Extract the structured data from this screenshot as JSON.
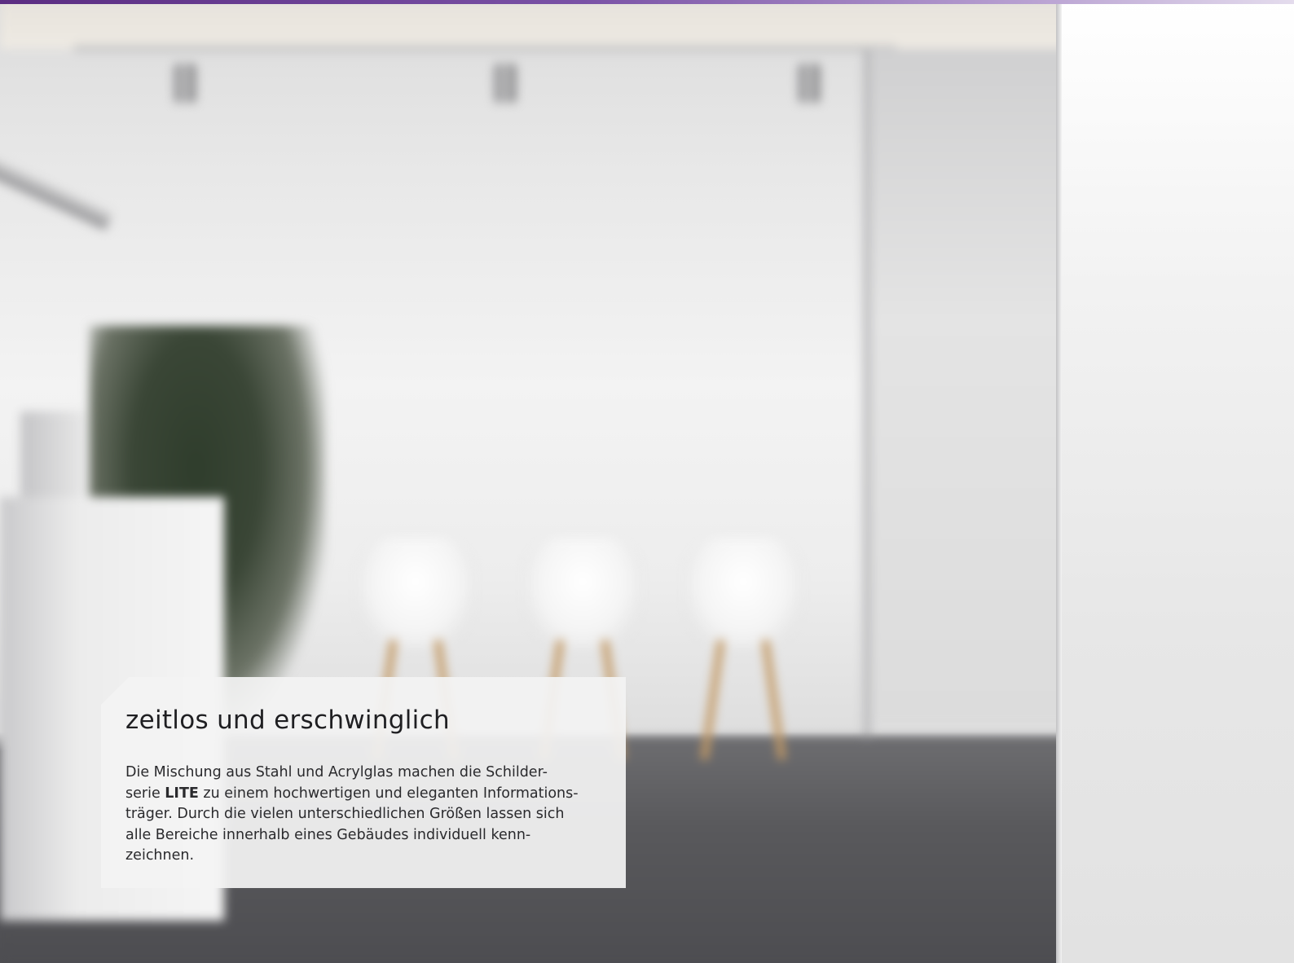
{
  "colors": {
    "accent_bar_start": "#5b2d82",
    "accent_bar_end": "#e4dced",
    "card_background": "#f3f3f3",
    "text": "#1f1f22"
  },
  "card": {
    "title": "zeitlos und erschwinglich",
    "body_lines": [
      {
        "before": "Die Mischung aus Stahl und Acrylglas machen die Schilder-",
        "bold": "",
        "after": ""
      },
      {
        "before": "serie ",
        "bold": "LITE",
        "after": " zu einem hochwertigen und eleganten Informations-"
      },
      {
        "before": "träger. Durch die vielen unterschiedlichen Größen lassen sich",
        "bold": "",
        "after": ""
      },
      {
        "before": "alle Bereiche innerhalb eines Gebäudes individuell kenn-",
        "bold": "",
        "after": ""
      },
      {
        "before": "zeichnen.",
        "bold": "",
        "after": ""
      }
    ]
  }
}
